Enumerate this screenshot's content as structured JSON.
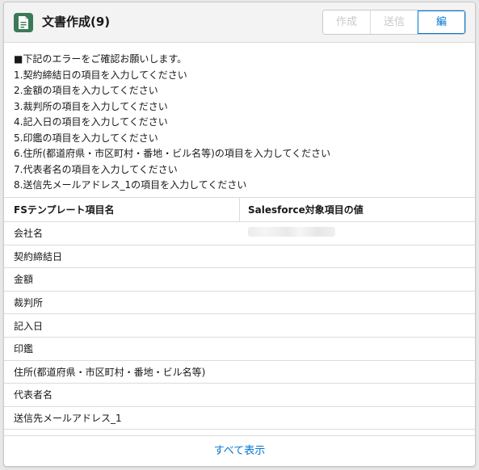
{
  "header": {
    "title": "文書作成(9)",
    "icon": "document-icon",
    "icon_color": "#3b7a57",
    "buttons": {
      "create": "作成",
      "send": "送信",
      "edit": "編集"
    }
  },
  "errors": [
    "■下記のエラーをご確認お願いします。",
    "1.契約締結日の項目を入力してください",
    "2.金額の項目を入力してください",
    "3.裁判所の項目を入力してください",
    "4.記入日の項目を入力してください",
    "5.印鑑の項目を入力してください",
    "6.住所(都道府県・市区町村・番地・ビル名等)の項目を入力してください",
    "7.代表者名の項目を入力してください",
    "8.送信先メールアドレス_1の項目を入力してください"
  ],
  "table": {
    "headers": [
      "FSテンプレート項目名",
      "Salesforce対象項目の値"
    ],
    "rows": [
      "会社名",
      "契約締結日",
      "金額",
      "裁判所",
      "記入日",
      "印鑑",
      "住所(都道府県・市区町村・番地・ビル名等)",
      "代表者名",
      "送信先メールアドレス_1"
    ]
  },
  "footer": {
    "view_all": "すべて表示"
  },
  "colors": {
    "link": "#0176d3",
    "border": "#dddbda"
  }
}
